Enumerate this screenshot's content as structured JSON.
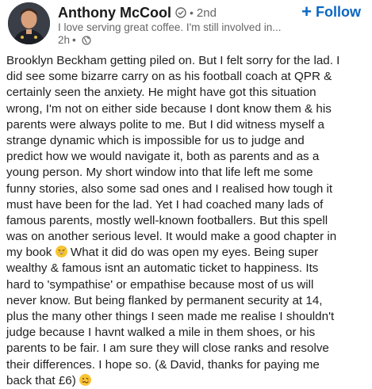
{
  "author": {
    "name": "Anthony McCool",
    "degree": "2nd",
    "headline": "I love serving great coffee. I'm still involved in...",
    "time": "2h",
    "visibility_icon": "globe-icon",
    "verified_icon": "verified-badge-icon"
  },
  "follow": {
    "label": "Follow",
    "icon": "plus-icon",
    "color": "#0a66c2"
  },
  "post": {
    "lines": [
      "Brooklyn Beckham getting piled on. But I felt sorry for the lad. I",
      "did see some bizarre carry on as his football coach at QPR &",
      "certainly seen the anxiety. He might have got this situation",
      "wrong, I'm not on either side because I dont know them & his",
      "parents were always polite to me. But I did witness myself a",
      "strange dynamic which is impossible for us to judge and",
      "predict how we would navigate it, both as parents and as a",
      "young person. My short window into that life left me some",
      "funny stories, also some sad ones and I realised how tough it",
      "must have been for the lad. Yet I had coached many lads of",
      "famous parents, mostly well-known footballers. But this spell",
      "was on another serious level. It would make a good chapter in",
      "my book",
      "What it did do was open my eyes. Being super",
      "wealthy & famous isnt an automatic ticket to happiness. Its",
      "hard to 'sympathise' or empathise because most of us will",
      "never know. But being flanked by permanent security at 14,",
      "plus the many other things I seen made me realise I shouldn't",
      "judge because I havnt walked a mile in them shoes, or his",
      "parents to be fair. I am sure they will close ranks and resolve",
      "their differences. I hope so. (& David, thanks for paying me",
      "back that £6)"
    ],
    "emoji_1": "grinning-sweat-emoji",
    "emoji_2": "woozy-face-emoji"
  }
}
